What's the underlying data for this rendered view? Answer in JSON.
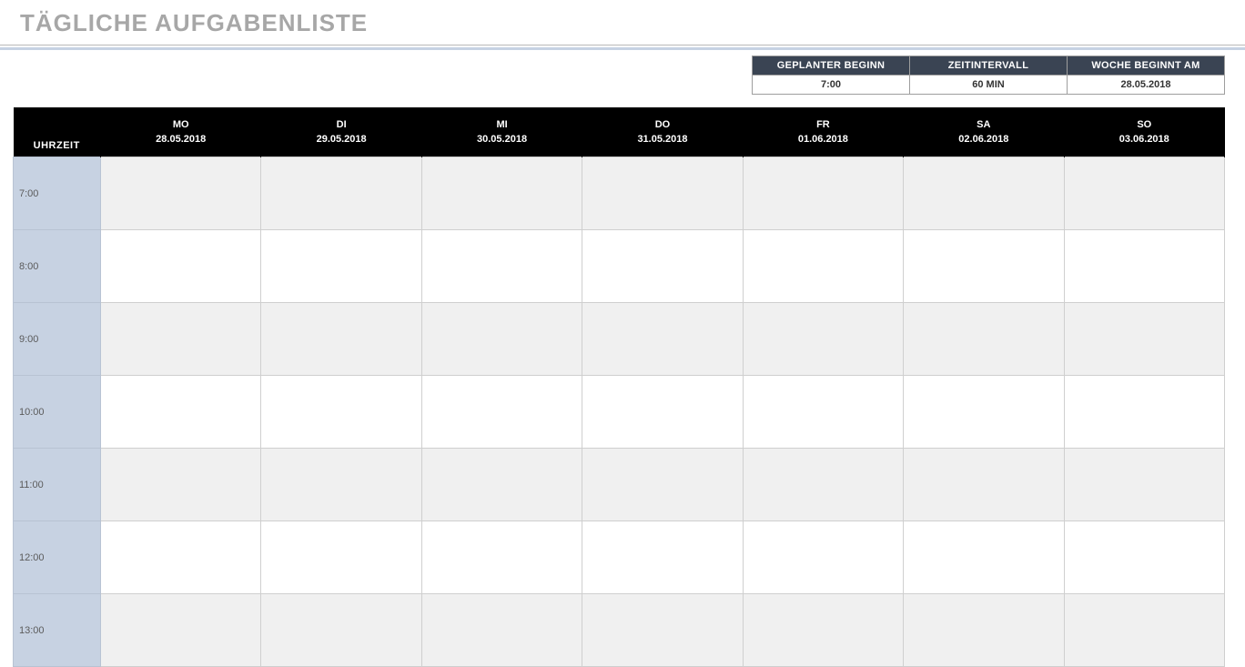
{
  "title": "TÄGLICHE AUFGABENLISTE",
  "meta": {
    "headers": [
      "GEPLANTER BEGINN",
      "ZEITINTERVALL",
      "WOCHE BEGINNT AM"
    ],
    "values": [
      "7:00",
      "60 MIN",
      "28.05.2018"
    ]
  },
  "schedule": {
    "time_header": "UHRZEIT",
    "days": [
      {
        "label": "MO",
        "date": "28.05.2018"
      },
      {
        "label": "DI",
        "date": "29.05.2018"
      },
      {
        "label": "MI",
        "date": "30.05.2018"
      },
      {
        "label": "DO",
        "date": "31.05.2018"
      },
      {
        "label": "FR",
        "date": "01.06.2018"
      },
      {
        "label": "SA",
        "date": "02.06.2018"
      },
      {
        "label": "SO",
        "date": "03.06.2018"
      }
    ],
    "times": [
      "7:00",
      "8:00",
      "9:00",
      "10:00",
      "11:00",
      "12:00",
      "13:00"
    ]
  }
}
